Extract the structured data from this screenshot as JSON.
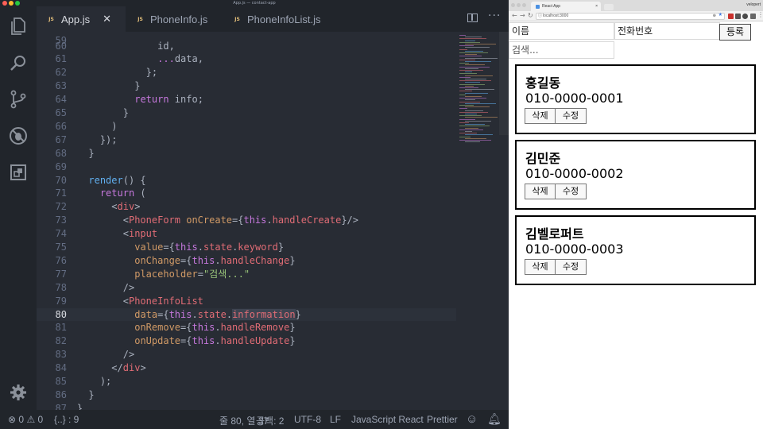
{
  "editor": {
    "window_title": "App.js — contact-app",
    "tabs": [
      {
        "label": "App.js",
        "badge": "JS",
        "active": true
      },
      {
        "label": "PhoneInfo.js",
        "badge": "JS",
        "active": false
      },
      {
        "label": "PhoneInfoList.js",
        "badge": "JS",
        "active": false
      }
    ],
    "activity_icons": [
      "files-icon",
      "search-icon",
      "source-control-icon",
      "debug-icon",
      "extensions-icon",
      "settings-icon"
    ],
    "current_line": 80,
    "lines": [
      {
        "n": "60",
        "indent": 10,
        "tokens": [
          {
            "t": "id,",
            "c": "pl"
          }
        ]
      },
      {
        "n": "61",
        "indent": 10,
        "tokens": [
          {
            "t": "...",
            "c": "kw"
          },
          {
            "t": "data,",
            "c": "pl"
          }
        ]
      },
      {
        "n": "62",
        "indent": 8,
        "tokens": [
          {
            "t": "};",
            "c": "pl"
          }
        ]
      },
      {
        "n": "63",
        "indent": 6,
        "tokens": [
          {
            "t": "}",
            "c": "pl"
          }
        ]
      },
      {
        "n": "64",
        "indent": 6,
        "tokens": [
          {
            "t": "return ",
            "c": "kw"
          },
          {
            "t": "info;",
            "c": "pl"
          }
        ]
      },
      {
        "n": "65",
        "indent": 4,
        "tokens": [
          {
            "t": "}",
            "c": "pl"
          }
        ]
      },
      {
        "n": "66",
        "indent": 2,
        "tokens": [
          {
            "t": ")",
            "c": "pl"
          }
        ]
      },
      {
        "n": "67",
        "indent": 0,
        "tokens": [
          {
            "t": "});",
            "c": "pl"
          }
        ]
      },
      {
        "n": "68",
        "indent": -2,
        "tokens": [
          {
            "t": "}",
            "c": "pl"
          }
        ]
      },
      {
        "n": "69",
        "indent": 0,
        "tokens": []
      },
      {
        "n": "70",
        "indent": -2,
        "tokens": [
          {
            "t": "render",
            "c": "fn"
          },
          {
            "t": "() {",
            "c": "pl"
          }
        ]
      },
      {
        "n": "71",
        "indent": 0,
        "tokens": [
          {
            "t": "return ",
            "c": "kw"
          },
          {
            "t": "(",
            "c": "pl"
          }
        ]
      },
      {
        "n": "72",
        "indent": 2,
        "tokens": [
          {
            "t": "<",
            "c": "pl"
          },
          {
            "t": "div",
            "c": "tag"
          },
          {
            "t": ">",
            "c": "pl"
          }
        ]
      },
      {
        "n": "73",
        "indent": 4,
        "tokens": [
          {
            "t": "<",
            "c": "pl"
          },
          {
            "t": "PhoneForm ",
            "c": "tag"
          },
          {
            "t": "onCreate",
            "c": "attr"
          },
          {
            "t": "={",
            "c": "pl"
          },
          {
            "t": "this",
            "c": "kw"
          },
          {
            "t": ".",
            "c": "pl"
          },
          {
            "t": "handleCreate",
            "c": "prop"
          },
          {
            "t": "}/>",
            "c": "pl"
          }
        ]
      },
      {
        "n": "74",
        "indent": 4,
        "tokens": [
          {
            "t": "<",
            "c": "pl"
          },
          {
            "t": "input",
            "c": "tag"
          }
        ]
      },
      {
        "n": "75",
        "indent": 6,
        "tokens": [
          {
            "t": "value",
            "c": "attr"
          },
          {
            "t": "={",
            "c": "pl"
          },
          {
            "t": "this",
            "c": "kw"
          },
          {
            "t": ".",
            "c": "pl"
          },
          {
            "t": "state",
            "c": "prop"
          },
          {
            "t": ".",
            "c": "pl"
          },
          {
            "t": "keyword",
            "c": "prop"
          },
          {
            "t": "}",
            "c": "pl"
          }
        ]
      },
      {
        "n": "76",
        "indent": 6,
        "tokens": [
          {
            "t": "onChange",
            "c": "attr"
          },
          {
            "t": "={",
            "c": "pl"
          },
          {
            "t": "this",
            "c": "kw"
          },
          {
            "t": ".",
            "c": "pl"
          },
          {
            "t": "handleChange",
            "c": "prop"
          },
          {
            "t": "}",
            "c": "pl"
          }
        ]
      },
      {
        "n": "77",
        "indent": 6,
        "tokens": [
          {
            "t": "placeholder",
            "c": "attr"
          },
          {
            "t": "=",
            "c": "pl"
          },
          {
            "t": "\"검색...\"",
            "c": "str"
          }
        ]
      },
      {
        "n": "78",
        "indent": 4,
        "tokens": [
          {
            "t": "/>",
            "c": "pl"
          }
        ]
      },
      {
        "n": "79",
        "indent": 4,
        "tokens": [
          {
            "t": "<",
            "c": "pl"
          },
          {
            "t": "PhoneInfoList",
            "c": "tag"
          }
        ]
      },
      {
        "n": "80",
        "indent": 6,
        "tokens": [
          {
            "t": "data",
            "c": "attr"
          },
          {
            "t": "={",
            "c": "pl"
          },
          {
            "t": "this",
            "c": "kw"
          },
          {
            "t": ".",
            "c": "pl"
          },
          {
            "t": "state",
            "c": "prop"
          },
          {
            "t": ".",
            "c": "pl"
          },
          {
            "t": "information",
            "c": "prop hl"
          },
          {
            "t": "}",
            "c": "pl"
          }
        ]
      },
      {
        "n": "81",
        "indent": 6,
        "tokens": [
          {
            "t": "onRemove",
            "c": "attr"
          },
          {
            "t": "={",
            "c": "pl"
          },
          {
            "t": "this",
            "c": "kw"
          },
          {
            "t": ".",
            "c": "pl"
          },
          {
            "t": "handleRemove",
            "c": "prop"
          },
          {
            "t": "}",
            "c": "pl"
          }
        ]
      },
      {
        "n": "82",
        "indent": 6,
        "tokens": [
          {
            "t": "onUpdate",
            "c": "attr"
          },
          {
            "t": "={",
            "c": "pl"
          },
          {
            "t": "this",
            "c": "kw"
          },
          {
            "t": ".",
            "c": "pl"
          },
          {
            "t": "handleUpdate",
            "c": "prop"
          },
          {
            "t": "}",
            "c": "pl"
          }
        ]
      },
      {
        "n": "83",
        "indent": 4,
        "tokens": [
          {
            "t": "/>",
            "c": "pl"
          }
        ]
      },
      {
        "n": "84",
        "indent": 2,
        "tokens": [
          {
            "t": "</",
            "c": "pl"
          },
          {
            "t": "div",
            "c": "tag"
          },
          {
            "t": ">",
            "c": "pl"
          }
        ]
      },
      {
        "n": "85",
        "indent": 0,
        "tokens": [
          {
            "t": ");",
            "c": "pl"
          }
        ]
      },
      {
        "n": "86",
        "indent": -2,
        "tokens": [
          {
            "t": "}",
            "c": "pl"
          }
        ]
      },
      {
        "n": "87",
        "indent": -4,
        "tokens": [
          {
            "t": "}",
            "c": "pl"
          }
        ]
      }
    ],
    "status": {
      "errors": "0",
      "warnings": "0",
      "braces": "{..} : 9",
      "position": "줄 80, 열 37",
      "spaces": "공백: 2",
      "encoding": "UTF-8",
      "eol": "LF",
      "language": "JavaScript React",
      "formatter": "Prettier"
    }
  },
  "browser": {
    "tab_title": "React App",
    "url": "localhost:3000",
    "user": "velopert",
    "form": {
      "name_placeholder": "이름",
      "phone_placeholder": "전화번호",
      "register_button": "등록",
      "search_placeholder": "검색..."
    },
    "contacts": [
      {
        "name": "홍길동",
        "phone": "010-0000-0001",
        "delete": "삭제",
        "edit": "수정"
      },
      {
        "name": "김민준",
        "phone": "010-0000-0002",
        "delete": "삭제",
        "edit": "수정"
      },
      {
        "name": "김벨로퍼트",
        "phone": "010-0000-0003",
        "delete": "삭제",
        "edit": "수정"
      }
    ]
  }
}
